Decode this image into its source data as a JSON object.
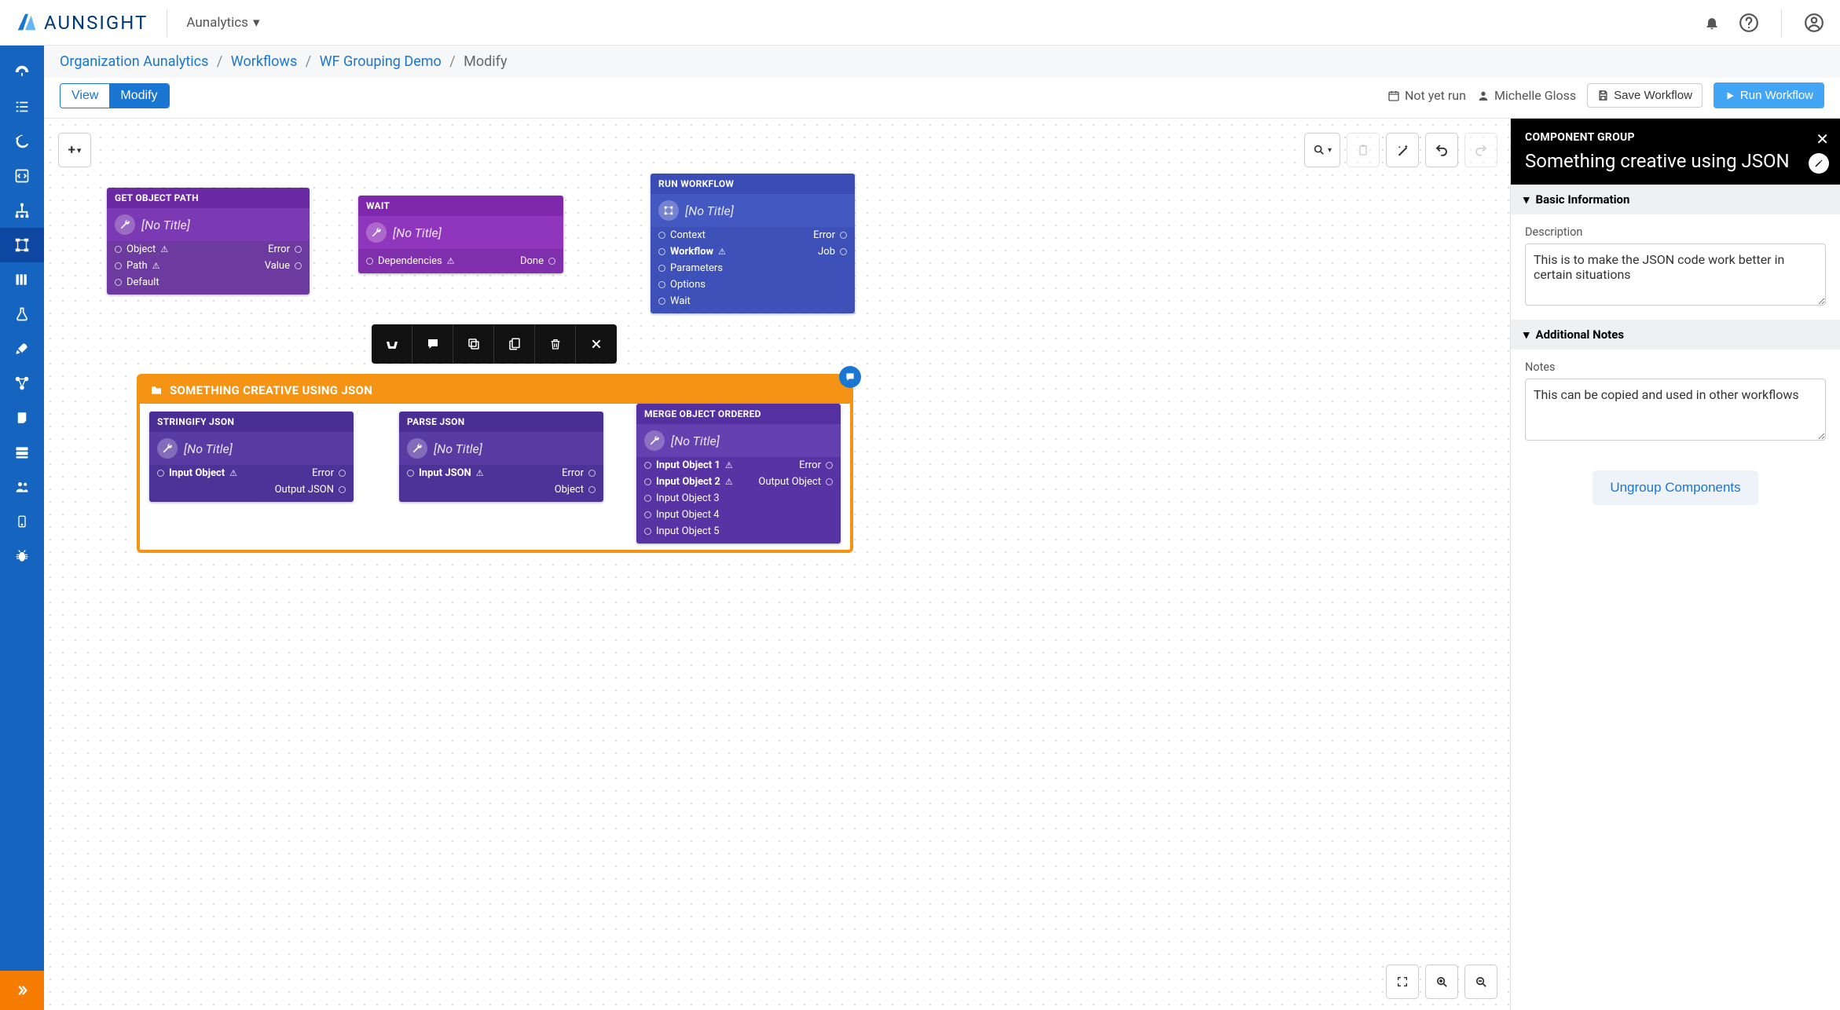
{
  "brand": "AUNSIGHT",
  "org_dropdown": "Aunalytics",
  "breadcrumb": {
    "org": "Organization Aunalytics",
    "workflows": "Workflows",
    "current": "WF Grouping Demo",
    "leaf": "Modify"
  },
  "toolbar": {
    "view": "View",
    "modify": "Modify",
    "not_run": "Not yet run",
    "user": "Michelle Gloss",
    "save": "Save Workflow",
    "run": "Run Workflow"
  },
  "nodes": {
    "get_object_path": {
      "header": "GET OBJECT PATH",
      "title": "[No Title]",
      "inputs": [
        "Object",
        "Path",
        "Default"
      ],
      "outputs": [
        "Error",
        "Value"
      ]
    },
    "wait": {
      "header": "WAIT",
      "title": "[No Title]",
      "inputs": [
        "Dependencies"
      ],
      "outputs": [
        "Done"
      ]
    },
    "run_workflow": {
      "header": "RUN WORKFLOW",
      "title": "[No Title]",
      "inputs": [
        "Context",
        "Workflow",
        "Parameters",
        "Options",
        "Wait"
      ],
      "outputs": [
        "Error",
        "Job"
      ]
    },
    "stringify": {
      "header": "STRINGIFY JSON",
      "title": "[No Title]",
      "inputs": [
        "Input Object"
      ],
      "outputs": [
        "Error",
        "Output JSON"
      ]
    },
    "parse": {
      "header": "PARSE JSON",
      "title": "[No Title]",
      "inputs": [
        "Input JSON"
      ],
      "outputs": [
        "Error",
        "Object"
      ]
    },
    "merge": {
      "header": "MERGE OBJECT ORDERED",
      "title": "[No Title]",
      "inputs": [
        "Input Object 1",
        "Input Object 2",
        "Input Object 3",
        "Input Object 4",
        "Input Object 5"
      ],
      "outputs": [
        "Error",
        "Output Object"
      ]
    }
  },
  "group": {
    "title": "SOMETHING CREATIVE USING JSON"
  },
  "inspector": {
    "tag": "COMPONENT GROUP",
    "title": "Something creative using JSON",
    "section_basic": "Basic Information",
    "desc_label": "Description",
    "desc_value": "This is to make the JSON code work better in certain situations",
    "section_notes": "Additional Notes",
    "notes_label": "Notes",
    "notes_value": "This can be copied and used in other workflows",
    "ungroup": "Ungroup Components"
  }
}
